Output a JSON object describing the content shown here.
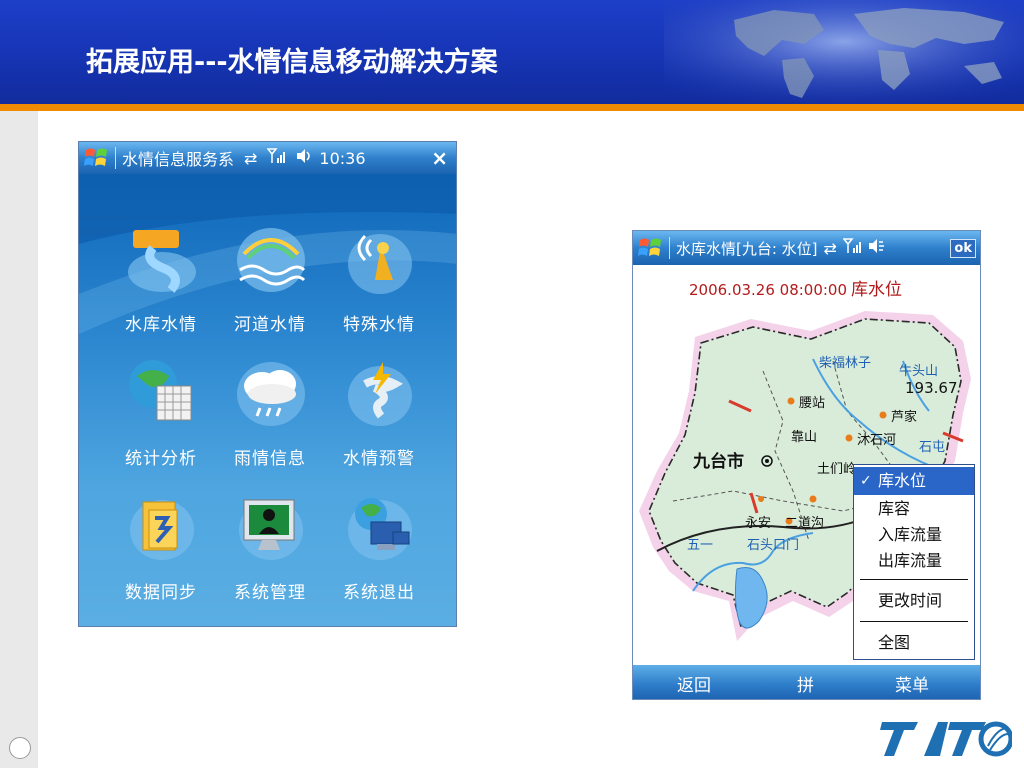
{
  "slide": {
    "title": "拓展应用---水情信息移动解决方案"
  },
  "phone_menu": {
    "titlebar": {
      "title": "水情信息服务系",
      "time": "10:36",
      "close": "×"
    },
    "tiles": [
      {
        "label": "水库水情",
        "icon": "reservoir-icon"
      },
      {
        "label": "河道水情",
        "icon": "river-icon"
      },
      {
        "label": "特殊水情",
        "icon": "special-water-icon"
      },
      {
        "label": "统计分析",
        "icon": "statistics-icon"
      },
      {
        "label": "雨情信息",
        "icon": "rain-icon"
      },
      {
        "label": "水情预警",
        "icon": "warning-icon"
      },
      {
        "label": "数据同步",
        "icon": "sync-icon"
      },
      {
        "label": "系统管理",
        "icon": "system-admin-icon"
      },
      {
        "label": "系统退出",
        "icon": "exit-icon"
      }
    ]
  },
  "phone_map": {
    "titlebar": {
      "title": "水库水情[九台: 水位]",
      "ok": "ok"
    },
    "datetime": "2006.03.26 08:00:00",
    "measure": "库水位",
    "map_labels": {
      "city": "九台市",
      "place_1": "柴福林子",
      "place_2": "牛头山",
      "value": "193.67",
      "place_3": "腰站",
      "place_4": "芦家",
      "place_5": "靠山",
      "place_6": "沐石河",
      "place_7": "石屯",
      "place_8": "土们岭",
      "place_9": "永安",
      "place_10": "二道沟",
      "place_11": "五一",
      "place_12": "石头口门"
    },
    "menu": {
      "items": [
        "库水位",
        "库容",
        "入库流量",
        "出库流量",
        "更改时间",
        "全图"
      ],
      "selected": "库水位",
      "check": "✓"
    },
    "softkeys": {
      "left": "返回",
      "middle": "拼",
      "right": "菜单"
    }
  },
  "logo": {
    "text": "TATO"
  },
  "colors": {
    "header_blue": "#1634b4",
    "accent_orange": "#f08a00",
    "menu_highlight": "#2a66c8",
    "map_fill": "#d9ecd9",
    "river_blue": "#4aa0e0",
    "label_red": "#b31b1b"
  }
}
